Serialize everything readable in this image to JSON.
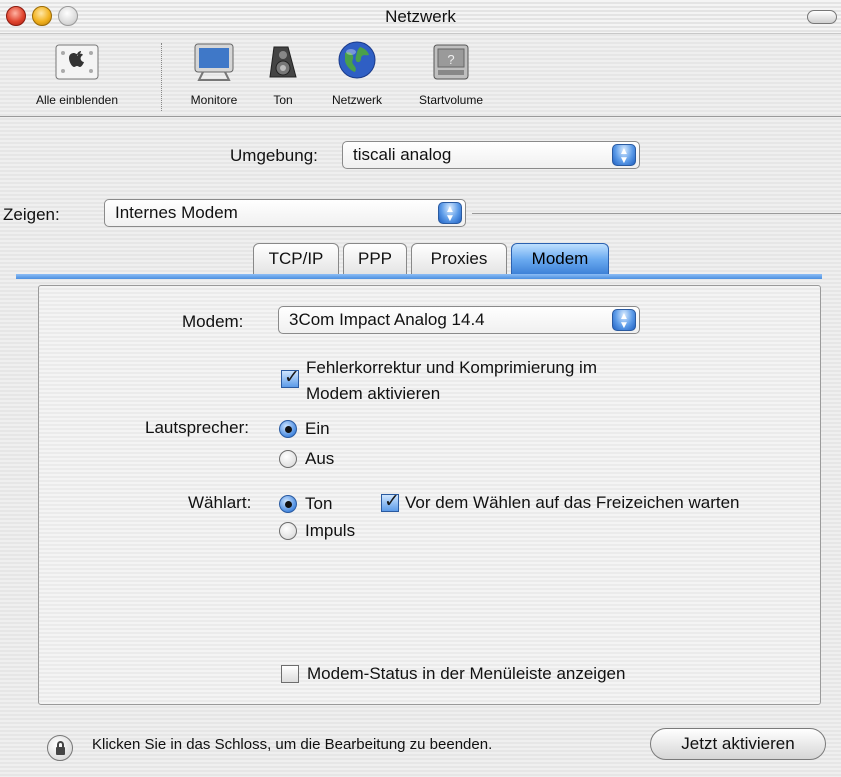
{
  "window": {
    "title": "Netzwerk"
  },
  "toolbar": {
    "items": [
      {
        "label": "Alle einblenden",
        "icon": "apple-grid-icon"
      },
      {
        "label": "Monitore",
        "icon": "monitor-icon"
      },
      {
        "label": "Ton",
        "icon": "speaker-icon"
      },
      {
        "label": "Netzwerk",
        "icon": "globe-icon"
      },
      {
        "label": "Startvolume",
        "icon": "hard-drive-icon"
      }
    ]
  },
  "location": {
    "label": "Umgebung:",
    "value": "tiscali analog"
  },
  "show": {
    "label": "Zeigen:",
    "value": "Internes Modem"
  },
  "tabs": [
    {
      "label": "TCP/IP",
      "active": false
    },
    {
      "label": "PPP",
      "active": false
    },
    {
      "label": "Proxies",
      "active": false
    },
    {
      "label": "Modem",
      "active": true
    }
  ],
  "modem": {
    "modem_label": "Modem:",
    "modem_value": "3Com Impact Analog 14.4",
    "error_correction_line1": "Fehlerkorrektur und Komprimierung im",
    "error_correction_line2": "Modem aktivieren",
    "error_correction_checked": true,
    "speaker_label": "Lautsprecher:",
    "speaker_on": "Ein",
    "speaker_off": "Aus",
    "speaker_selected": "Ein",
    "dial_label": "Wählart:",
    "dial_tone": "Ton",
    "dial_pulse": "Impuls",
    "dial_selected": "Ton",
    "wait_dialtone": "Vor dem Wählen auf das Freizeichen warten",
    "wait_dialtone_checked": true,
    "status_menubar": "Modem-Status in der Menüleiste anzeigen",
    "status_menubar_checked": false
  },
  "footer": {
    "lock_text": "Klicken Sie in das Schloss, um die Bearbeitung zu beenden.",
    "apply_button": "Jetzt aktivieren"
  },
  "colors": {
    "accent": "#4b8fe0",
    "close": "#e0442e",
    "minimize": "#f2b21f"
  }
}
